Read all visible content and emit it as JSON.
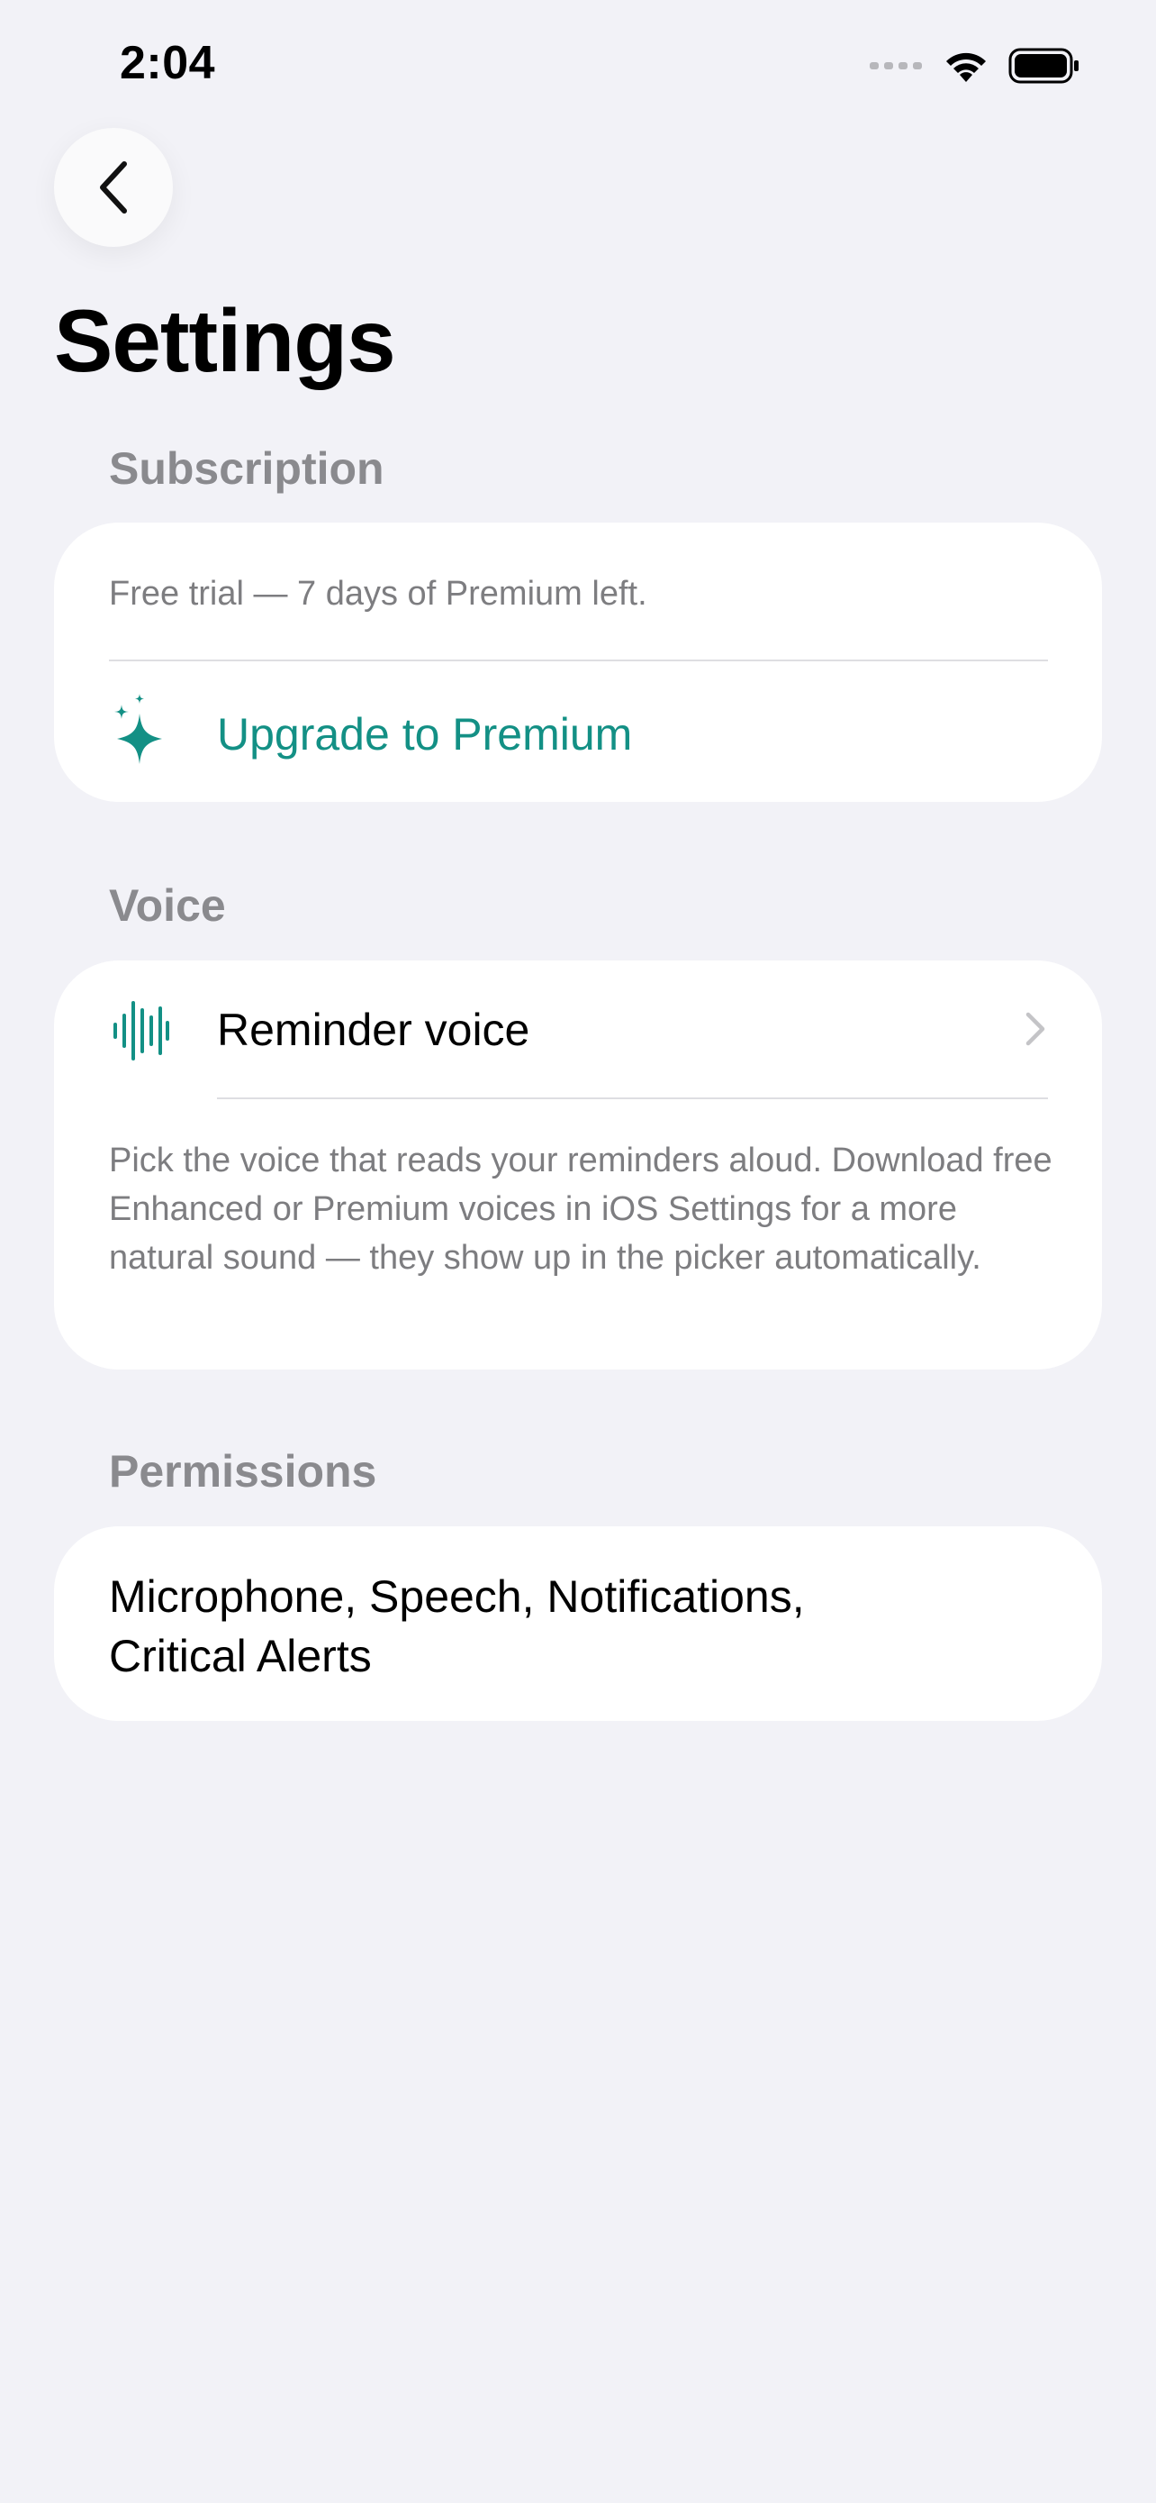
{
  "status_bar": {
    "time": "2:04",
    "icons": [
      "cellular-signal-icon",
      "wifi-icon",
      "battery-icon"
    ]
  },
  "nav": {
    "back_icon": "chevron-left-icon"
  },
  "page": {
    "title": "Settings"
  },
  "subscription": {
    "header": "Subscription",
    "trial_text": "Free trial — 7 days of Premium left.",
    "upgrade_label": "Upgrade to Premium",
    "upgrade_icon": "sparkles-icon"
  },
  "voice": {
    "header": "Voice",
    "row_label": "Reminder voice",
    "row_icon": "waveform-icon",
    "description": "Pick the voice that reads your reminders aloud. Download free Enhanced or Premium voices in iOS Settings for a more natural sound — they show up in the picker automatically."
  },
  "permissions": {
    "header": "Permissions",
    "text": "Microphone, Speech, Notifications, Critical Alerts"
  },
  "colors": {
    "background": "#f2f2f7",
    "accent": "#139085",
    "secondary_text": "#7d7d80",
    "section_header": "#8a8a8e"
  }
}
